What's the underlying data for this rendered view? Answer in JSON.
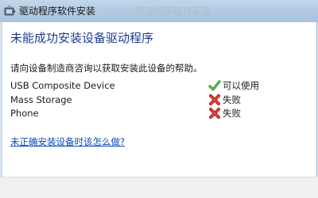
{
  "window": {
    "title": "驱动程序软件安装",
    "title_ghost": "驱动程序软件安装"
  },
  "main": {
    "heading": "未能成功安装设备驱动程序",
    "description": "请向设备制造商咨询以获取安装此设备的帮助。",
    "devices": [
      {
        "name": "USB Composite Device",
        "status": "可以使用",
        "status_icon": "checkmark-icon"
      },
      {
        "name": "Mass Storage",
        "status": "失败",
        "status_icon": "error-x-icon"
      },
      {
        "name": "Phone",
        "status": "失败",
        "status_icon": "error-x-icon"
      }
    ],
    "help_link": "未正确安装设备时该怎么做?"
  },
  "colors": {
    "heading": "#1e3d8f",
    "link": "#0b4cbb",
    "success": "#3aa82e",
    "error": "#d0302b",
    "titlebar": "#b3cbe2"
  }
}
